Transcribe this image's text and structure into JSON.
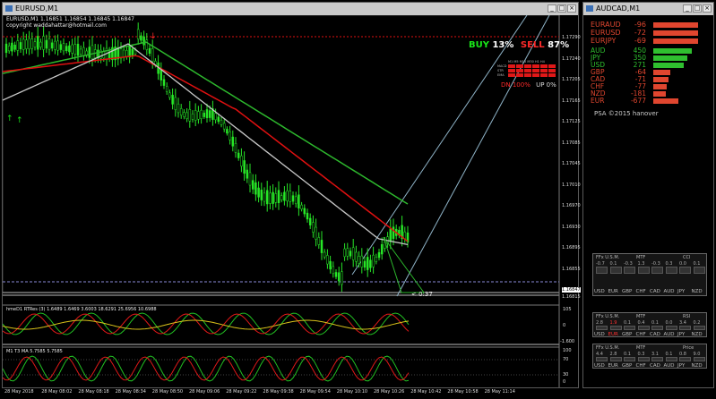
{
  "main_window": {
    "title": "EURUSD,M1",
    "info_line": "EURUSD,M1  1.16851 1.16854 1.16845 1.16847",
    "copyright": "copyright waddahattar@hotmail.com",
    "buy_label": "BUY",
    "buy_pct": "13%",
    "sell_label": "SELL",
    "sell_pct": "87%",
    "dn_label": "DN 100%",
    "up_label": "UP 0%",
    "tf_labels": [
      "M1",
      "M5",
      "M15",
      "M30",
      "H1",
      "H4"
    ],
    "row_labels": [
      "MACD",
      "STR",
      "EMA"
    ],
    "countdown": "< 0:37",
    "price_scale": [
      "1.17290",
      "1.17240",
      "1.17205",
      "1.17165",
      "1.17125",
      "1.17085",
      "1.17045",
      "1.17010",
      "1.16970",
      "1.16930",
      "1.16895",
      "1.16855",
      "1.16847",
      "1.16815"
    ],
    "time_axis": [
      "28 May 2018",
      "28 May 08:02",
      "28 May 08:18",
      "28 May 08:34",
      "28 May 08:50",
      "28 May 09:06",
      "28 May 09:22",
      "28 May 09:38",
      "28 May 09:54",
      "28 May 10:10",
      "28 May 10:26",
      "28 May 10:42",
      "28 May 10:58",
      "28 May 11:14"
    ],
    "sub1_label": "hmeD1  RTRes (3) 1.6489 1.6469 3.6003 18.6291 25.6956 10.6988",
    "sub1_scale": [
      "105",
      "0",
      "-1.600"
    ],
    "sub2_label": "M1  T3 MA  5.7585 5.7585",
    "sub2_scale": [
      "100",
      "70",
      "30",
      "0"
    ]
  },
  "currency_window": {
    "title": "AUDCAD,M1",
    "pairs": [
      {
        "name": "EURAUD",
        "value": "-96"
      },
      {
        "name": "EURUSD",
        "value": "-72"
      },
      {
        "name": "EURJPY",
        "value": "-69"
      }
    ],
    "strength": [
      {
        "name": "AUD",
        "value": "450",
        "strength": 0.7,
        "color": "#2fbf2f"
      },
      {
        "name": "JPY",
        "value": "350",
        "strength": 0.62,
        "color": "#2fbf2f"
      },
      {
        "name": "USD",
        "value": "271",
        "strength": 0.55,
        "color": "#2fbf2f"
      },
      {
        "name": "GBP",
        "value": "-64",
        "strength": 0.3,
        "color": "#e0462f"
      },
      {
        "name": "CAD",
        "value": "-71",
        "strength": 0.28,
        "color": "#e0462f"
      },
      {
        "name": "CHF",
        "value": "-77",
        "strength": 0.24,
        "color": "#e0462f"
      },
      {
        "name": "NZD",
        "value": "-181",
        "strength": 0.22,
        "color": "#e0462f"
      },
      {
        "name": "EUR",
        "value": "-677",
        "strength": 0.45,
        "color": "#e0462f"
      }
    ],
    "copyright": "PSA ©2015 hanover",
    "panels": [
      {
        "name": "FFx U.S.M.",
        "mtf": "MTF",
        "ind": "CCI",
        "values": [
          "-0.7",
          "0.1",
          "-0.3",
          "1.3",
          "-0.3",
          "0.3",
          "0.0",
          "0.1"
        ]
      },
      {
        "name": "FFx U.S.M.",
        "mtf": "MTF",
        "ind": "RSI",
        "values": [
          "2.8",
          "1.9",
          "0.1",
          "0.4",
          "0.1",
          "0.0",
          "3.4",
          "0.2"
        ]
      },
      {
        "name": "FFx U.S.M.",
        "mtf": "MTF",
        "ind": "Price",
        "values": [
          "4.4",
          "2.8",
          "0.1",
          "0.3",
          "3.1",
          "0.1",
          "0.8",
          "9.0"
        ]
      }
    ],
    "currencies": [
      "USD",
      "EUR",
      "GBP",
      "CHF",
      "CAD",
      "AUD",
      "JPY",
      "NZD"
    ]
  },
  "colors": {
    "buy": "#19e619",
    "sell": "#ff2a2a",
    "candle": "#27e627",
    "ma_red": "#e01010",
    "ma_green": "#2db82d",
    "ma_white": "#c8c8c8"
  }
}
